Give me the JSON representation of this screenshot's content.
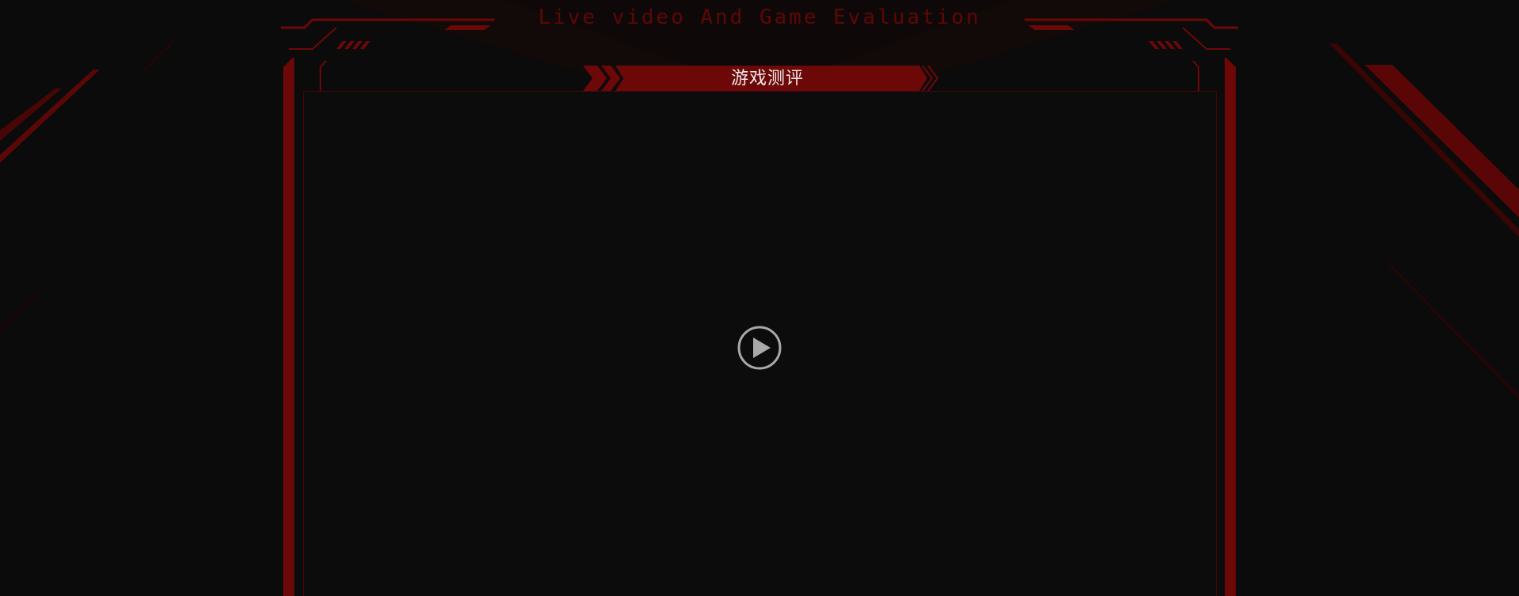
{
  "header": {
    "subtitle": "Live video And Game Evaluation",
    "title": "游戏测评"
  },
  "video": {
    "play_icon": "play-circle-icon"
  },
  "colors": {
    "background": "#0b0b0b",
    "accent_red": "#6d0808",
    "dim_red": "#3a0505",
    "subtitle_text": "#5e0707",
    "title_text": "#f2eaea",
    "play_icon": "#a9a9a9"
  }
}
